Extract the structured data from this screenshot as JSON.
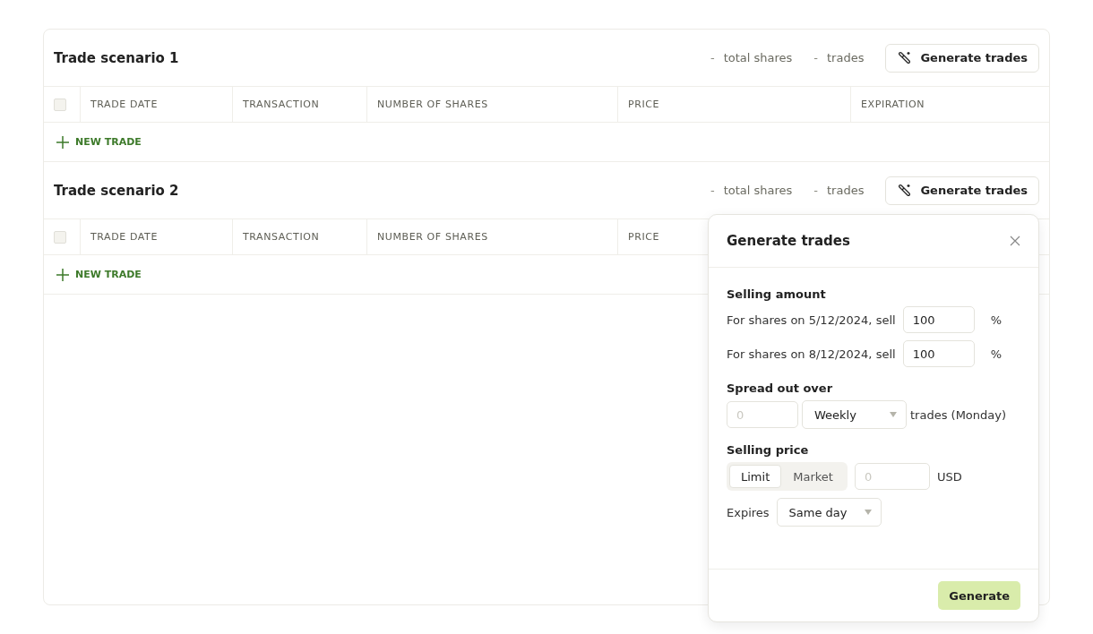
{
  "scenarios": [
    {
      "title": "Trade scenario 1",
      "total_shares": "-",
      "total_shares_label": "total shares",
      "trades": "-",
      "trades_label": "trades",
      "button": "Generate trades",
      "select_all_checked": false,
      "columns": [
        "TRADE DATE",
        "TRANSACTION",
        "NUMBER OF SHARES",
        "PRICE",
        "EXPIRATION"
      ],
      "add_label": "NEW TRADE"
    },
    {
      "title": "Trade scenario 2",
      "total_shares": "-",
      "total_shares_label": "total shares",
      "trades": "-",
      "trades_label": "trades",
      "button": "Generate trades",
      "select_all_checked": false,
      "columns": [
        "TRADE DATE",
        "TRANSACTION",
        "NUMBER OF SHARES",
        "PRICE"
      ],
      "add_label": "NEW TRADE"
    }
  ],
  "dialog": {
    "title": "Generate trades",
    "selling_amount": {
      "heading": "Selling amount",
      "rows": [
        {
          "label": "For shares on 5/12/2024, sell",
          "value": "100",
          "unit": "%"
        },
        {
          "label": "For shares on 8/12/2024, sell",
          "value": "100",
          "unit": "%"
        }
      ]
    },
    "spread": {
      "heading": "Spread out over",
      "placeholder": "0",
      "frequency": "Weekly",
      "suffix": "trades (Monday)"
    },
    "price": {
      "heading": "Selling price",
      "modes": [
        {
          "label": "Limit",
          "selected": true
        },
        {
          "label": "Market",
          "selected": false
        }
      ],
      "placeholder": "0",
      "unit": "USD",
      "expires_label": "Expires",
      "expires": "Same day"
    },
    "submit": "Generate"
  }
}
